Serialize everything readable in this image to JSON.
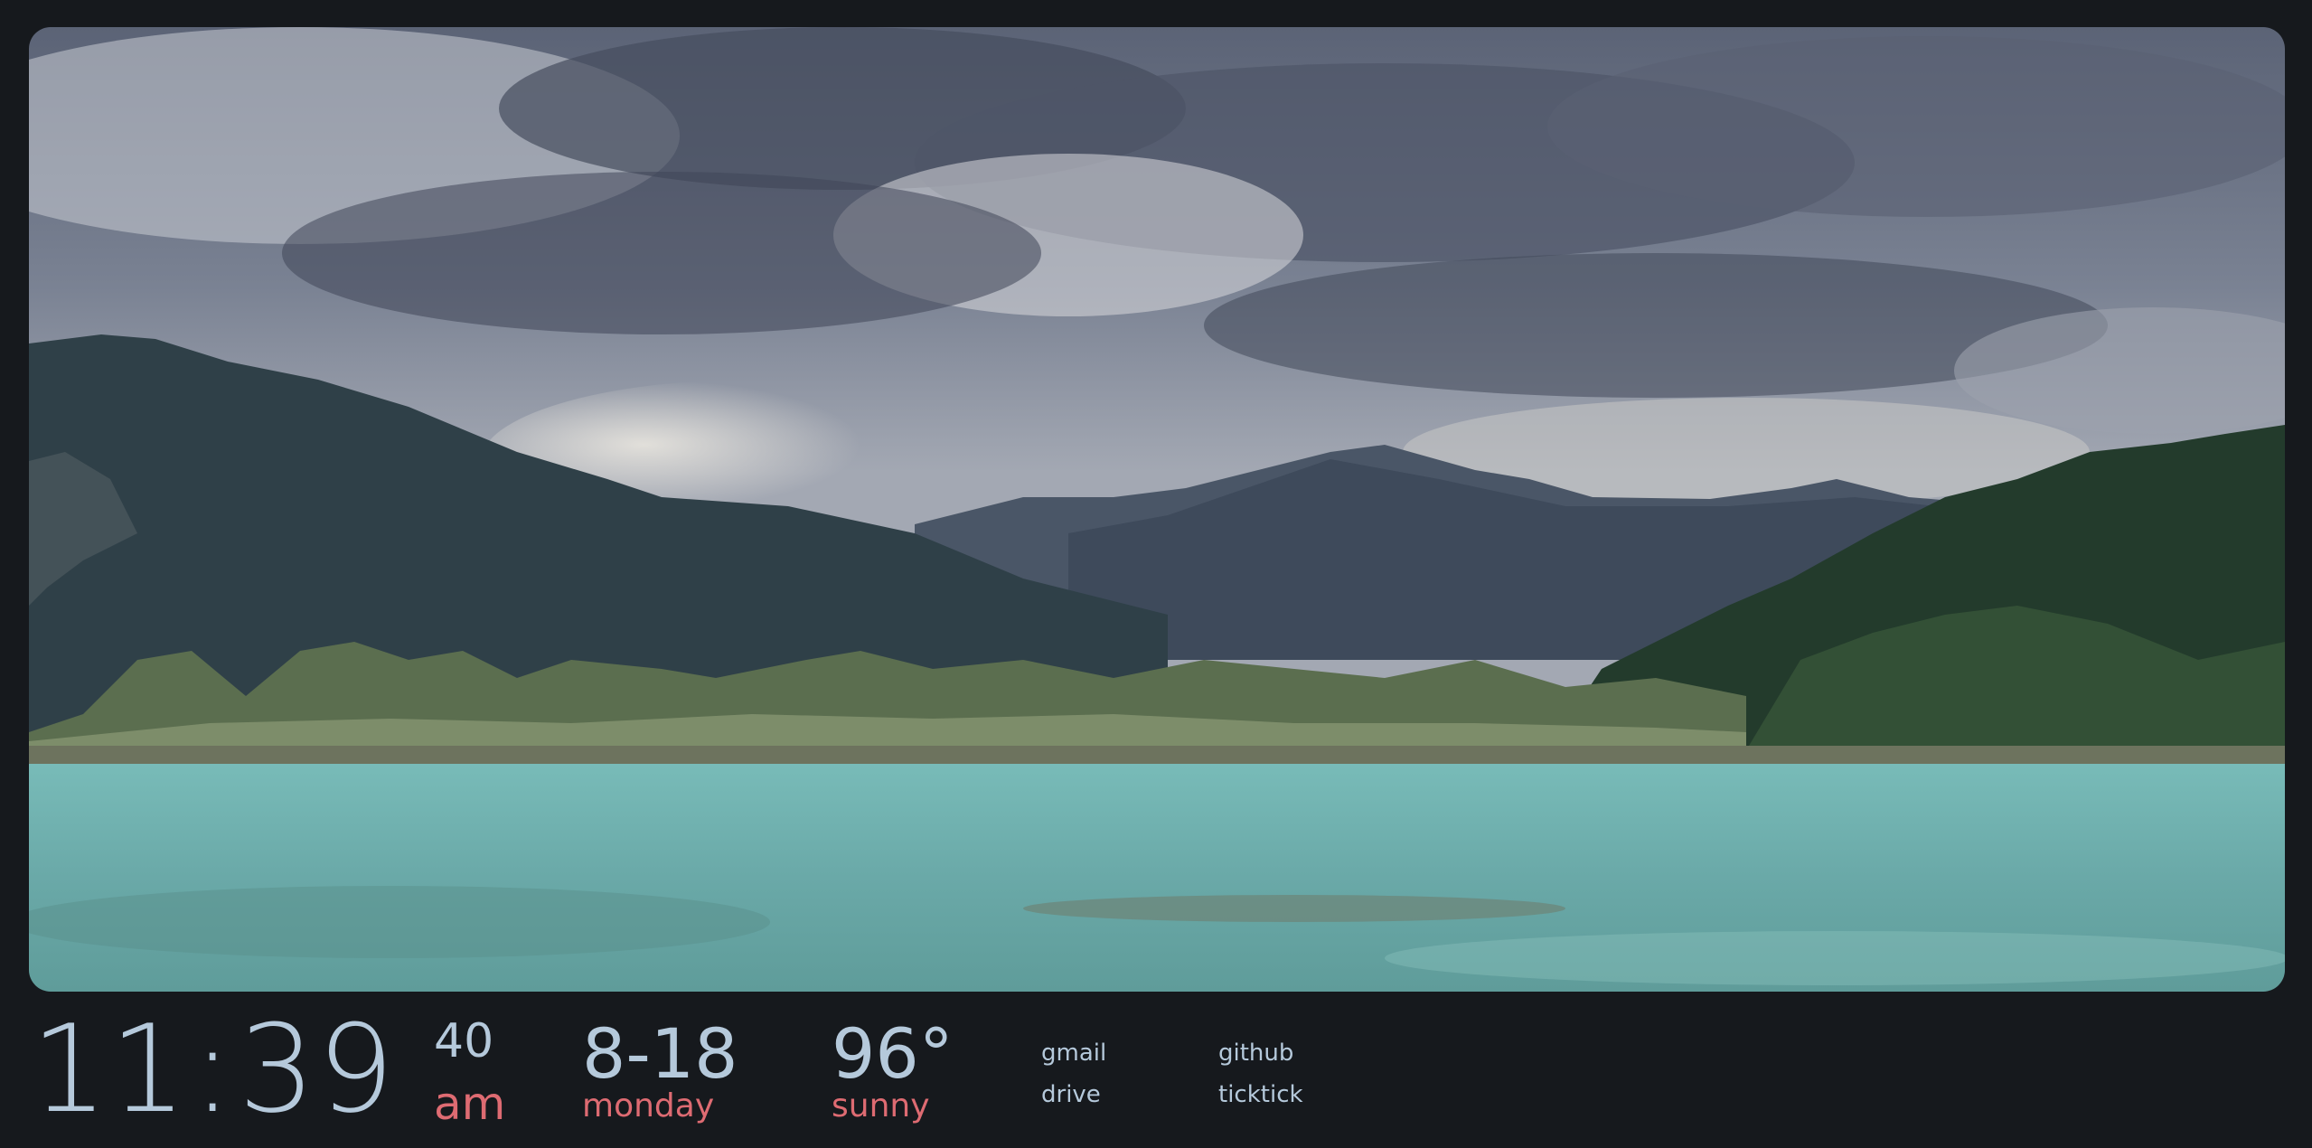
{
  "wallpaper": {
    "icon": "landscape-photo",
    "colors": {
      "sky": "#7e8594",
      "cloud_dark": "#4a5163",
      "mountain": "#3a4b58",
      "forest": "#2e4a3a",
      "water": "#6fb5b2"
    }
  },
  "clock": {
    "hours": "11",
    "separator": ":",
    "minutes": "39",
    "seconds": "40",
    "meridiem": "am"
  },
  "date": {
    "value": "8-18",
    "weekday": "monday"
  },
  "weather": {
    "temperature": "96°",
    "condition": "sunny"
  },
  "links": [
    {
      "label": "gmail"
    },
    {
      "label": "drive"
    },
    {
      "label": "github"
    },
    {
      "label": "ticktick"
    }
  ],
  "theme": {
    "background": "#16191d",
    "primary_text": "#b5c9db",
    "accent_text": "#de6b72"
  }
}
